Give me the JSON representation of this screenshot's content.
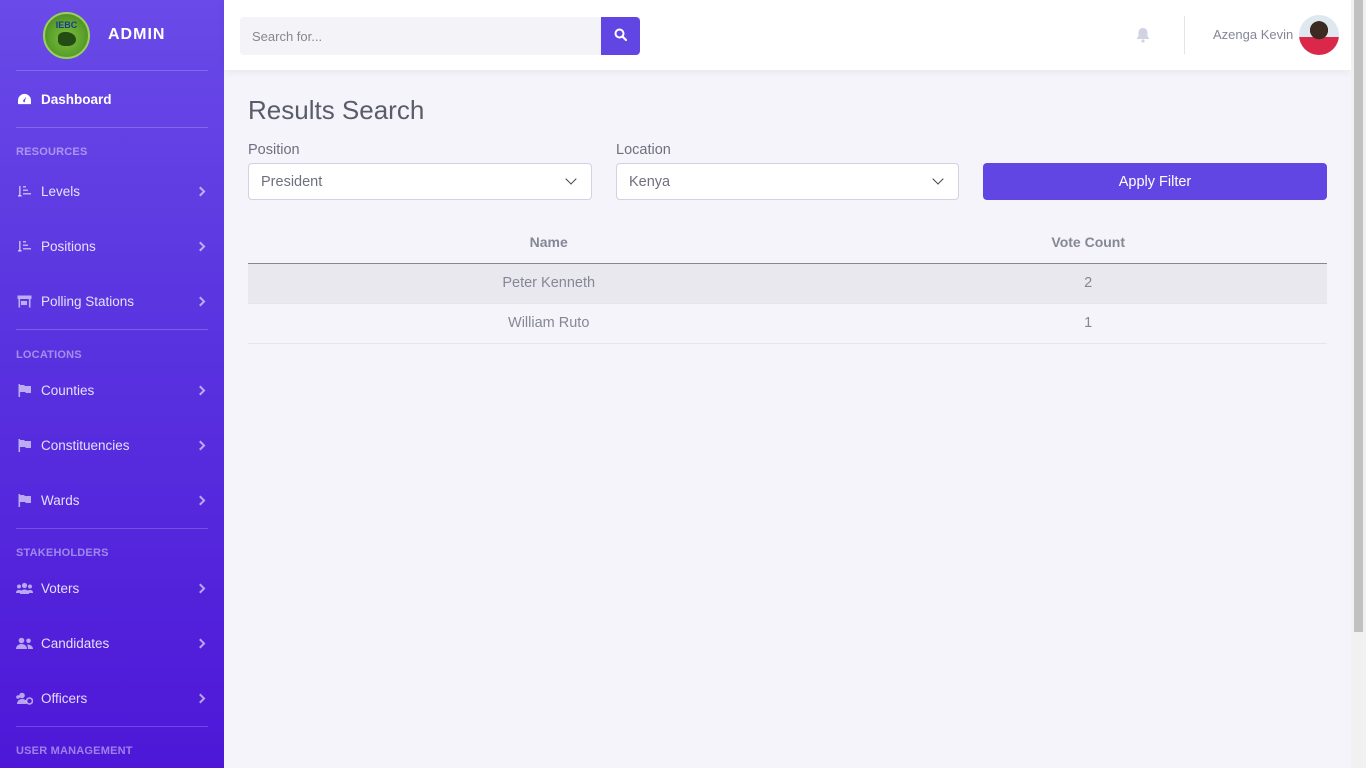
{
  "sidebar": {
    "brand": "ADMIN",
    "logo_text": "IEBC",
    "dashboard": "Dashboard",
    "sections": [
      {
        "heading": "RESOURCES",
        "items": [
          "Levels",
          "Positions",
          "Polling Stations"
        ]
      },
      {
        "heading": "LOCATIONS",
        "items": [
          "Counties",
          "Constituencies",
          "Wards"
        ]
      },
      {
        "heading": "STAKEHOLDERS",
        "items": [
          "Voters",
          "Candidates",
          "Officers"
        ]
      },
      {
        "heading": "USER MANAGEMENT",
        "items": []
      }
    ]
  },
  "topbar": {
    "search_placeholder": "Search for...",
    "user_name": "Azenga Kevin"
  },
  "main": {
    "title": "Results Search",
    "position_label": "Position",
    "position_value": "President",
    "location_label": "Location",
    "location_value": "Kenya",
    "apply_label": "Apply Filter",
    "table": {
      "headers": [
        "Name",
        "Vote Count"
      ],
      "rows": [
        [
          "Peter Kenneth",
          "2"
        ],
        [
          "William Ruto",
          "1"
        ]
      ]
    }
  },
  "colors": {
    "accent": "#6246e3",
    "sidebar_top": "#6a4ae8",
    "sidebar_bottom": "#4e17d8"
  }
}
